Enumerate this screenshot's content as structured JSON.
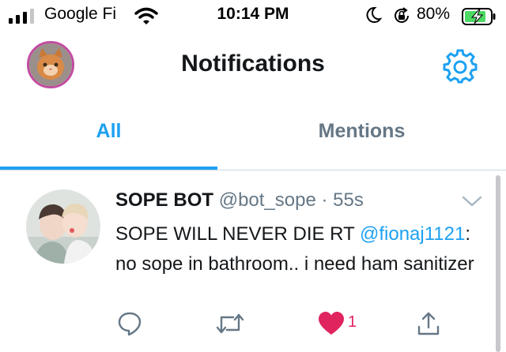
{
  "status_bar": {
    "carrier": "Google Fi",
    "time": "10:14 PM",
    "battery_percent": "80%",
    "icons": [
      "signal-icon",
      "wifi-icon",
      "moon-icon",
      "rotation-lock-icon",
      "battery-charging-icon"
    ]
  },
  "header": {
    "title": "Notifications",
    "avatar": "profile-avatar",
    "settings_icon": "gear-icon"
  },
  "tabs": [
    {
      "label": "All",
      "active": true
    },
    {
      "label": "Mentions",
      "active": false
    }
  ],
  "tweet": {
    "display_name": "SOPE BOT",
    "handle": "@bot_sope",
    "separator": " · ",
    "time": "55s",
    "text_prefix": "SOPE WILL NEVER DIE  RT ",
    "mention": "@fionaj1121",
    "text_suffix": ": no sope in bathroom.. i need ham sanitizer",
    "like_count": "1",
    "liked": true
  },
  "colors": {
    "accent": "#1da1f2",
    "like": "#e0245e",
    "secondary_text": "#657786",
    "battery_green": "#4cd964"
  }
}
